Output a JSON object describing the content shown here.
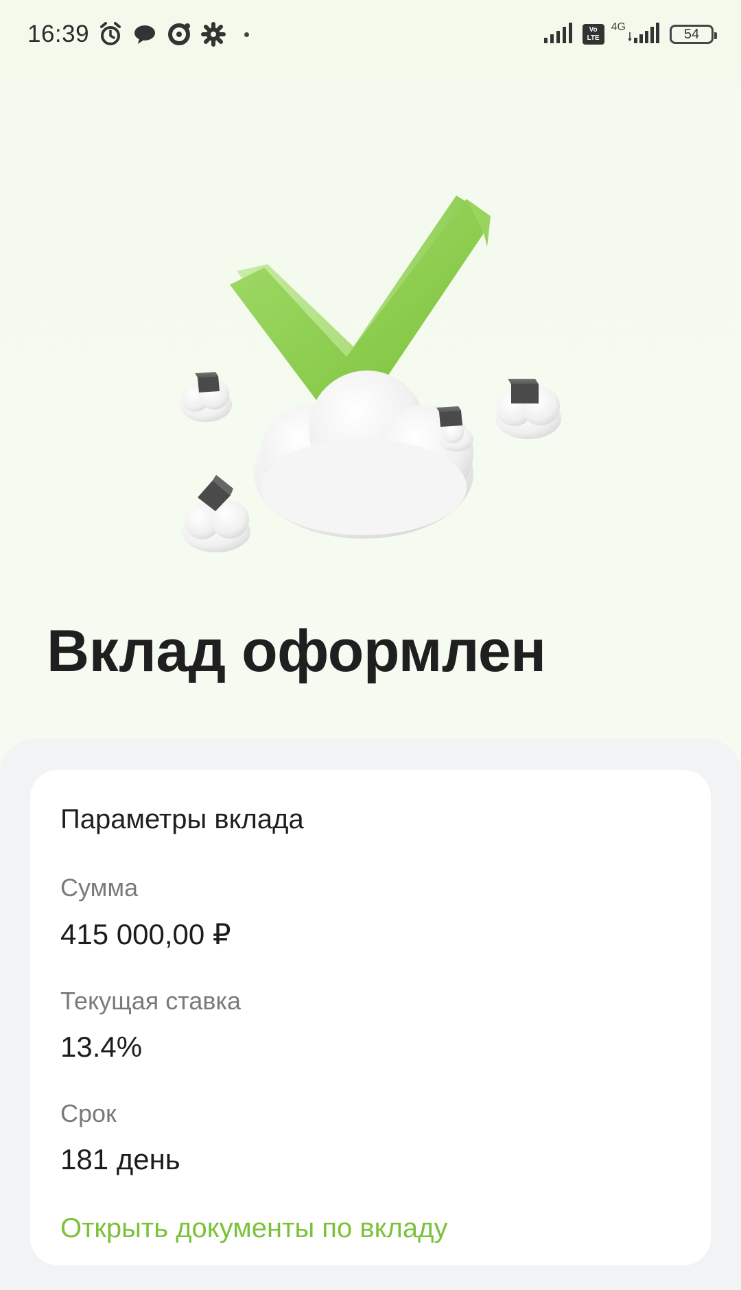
{
  "status_bar": {
    "time": "16:39",
    "icons": [
      "alarm-icon",
      "message-icon",
      "sync-icon",
      "settings-icon",
      "dot-icon"
    ],
    "network": "4G",
    "volte": "Vo LTE",
    "battery": "54"
  },
  "hero": {
    "icon": "checkmark-on-cloud-illustration",
    "accent_color": "#8cd04f"
  },
  "title": "Вклад оформлен",
  "card": {
    "title": "Параметры вклада",
    "fields": [
      {
        "label": "Сумма",
        "value": "415 000,00 ₽"
      },
      {
        "label": "Текущая ставка",
        "value": "13.4%"
      },
      {
        "label": "Срок",
        "value": "181 день"
      }
    ],
    "link": "Открыть документы по вкладу",
    "link_color": "#7cc13a"
  }
}
